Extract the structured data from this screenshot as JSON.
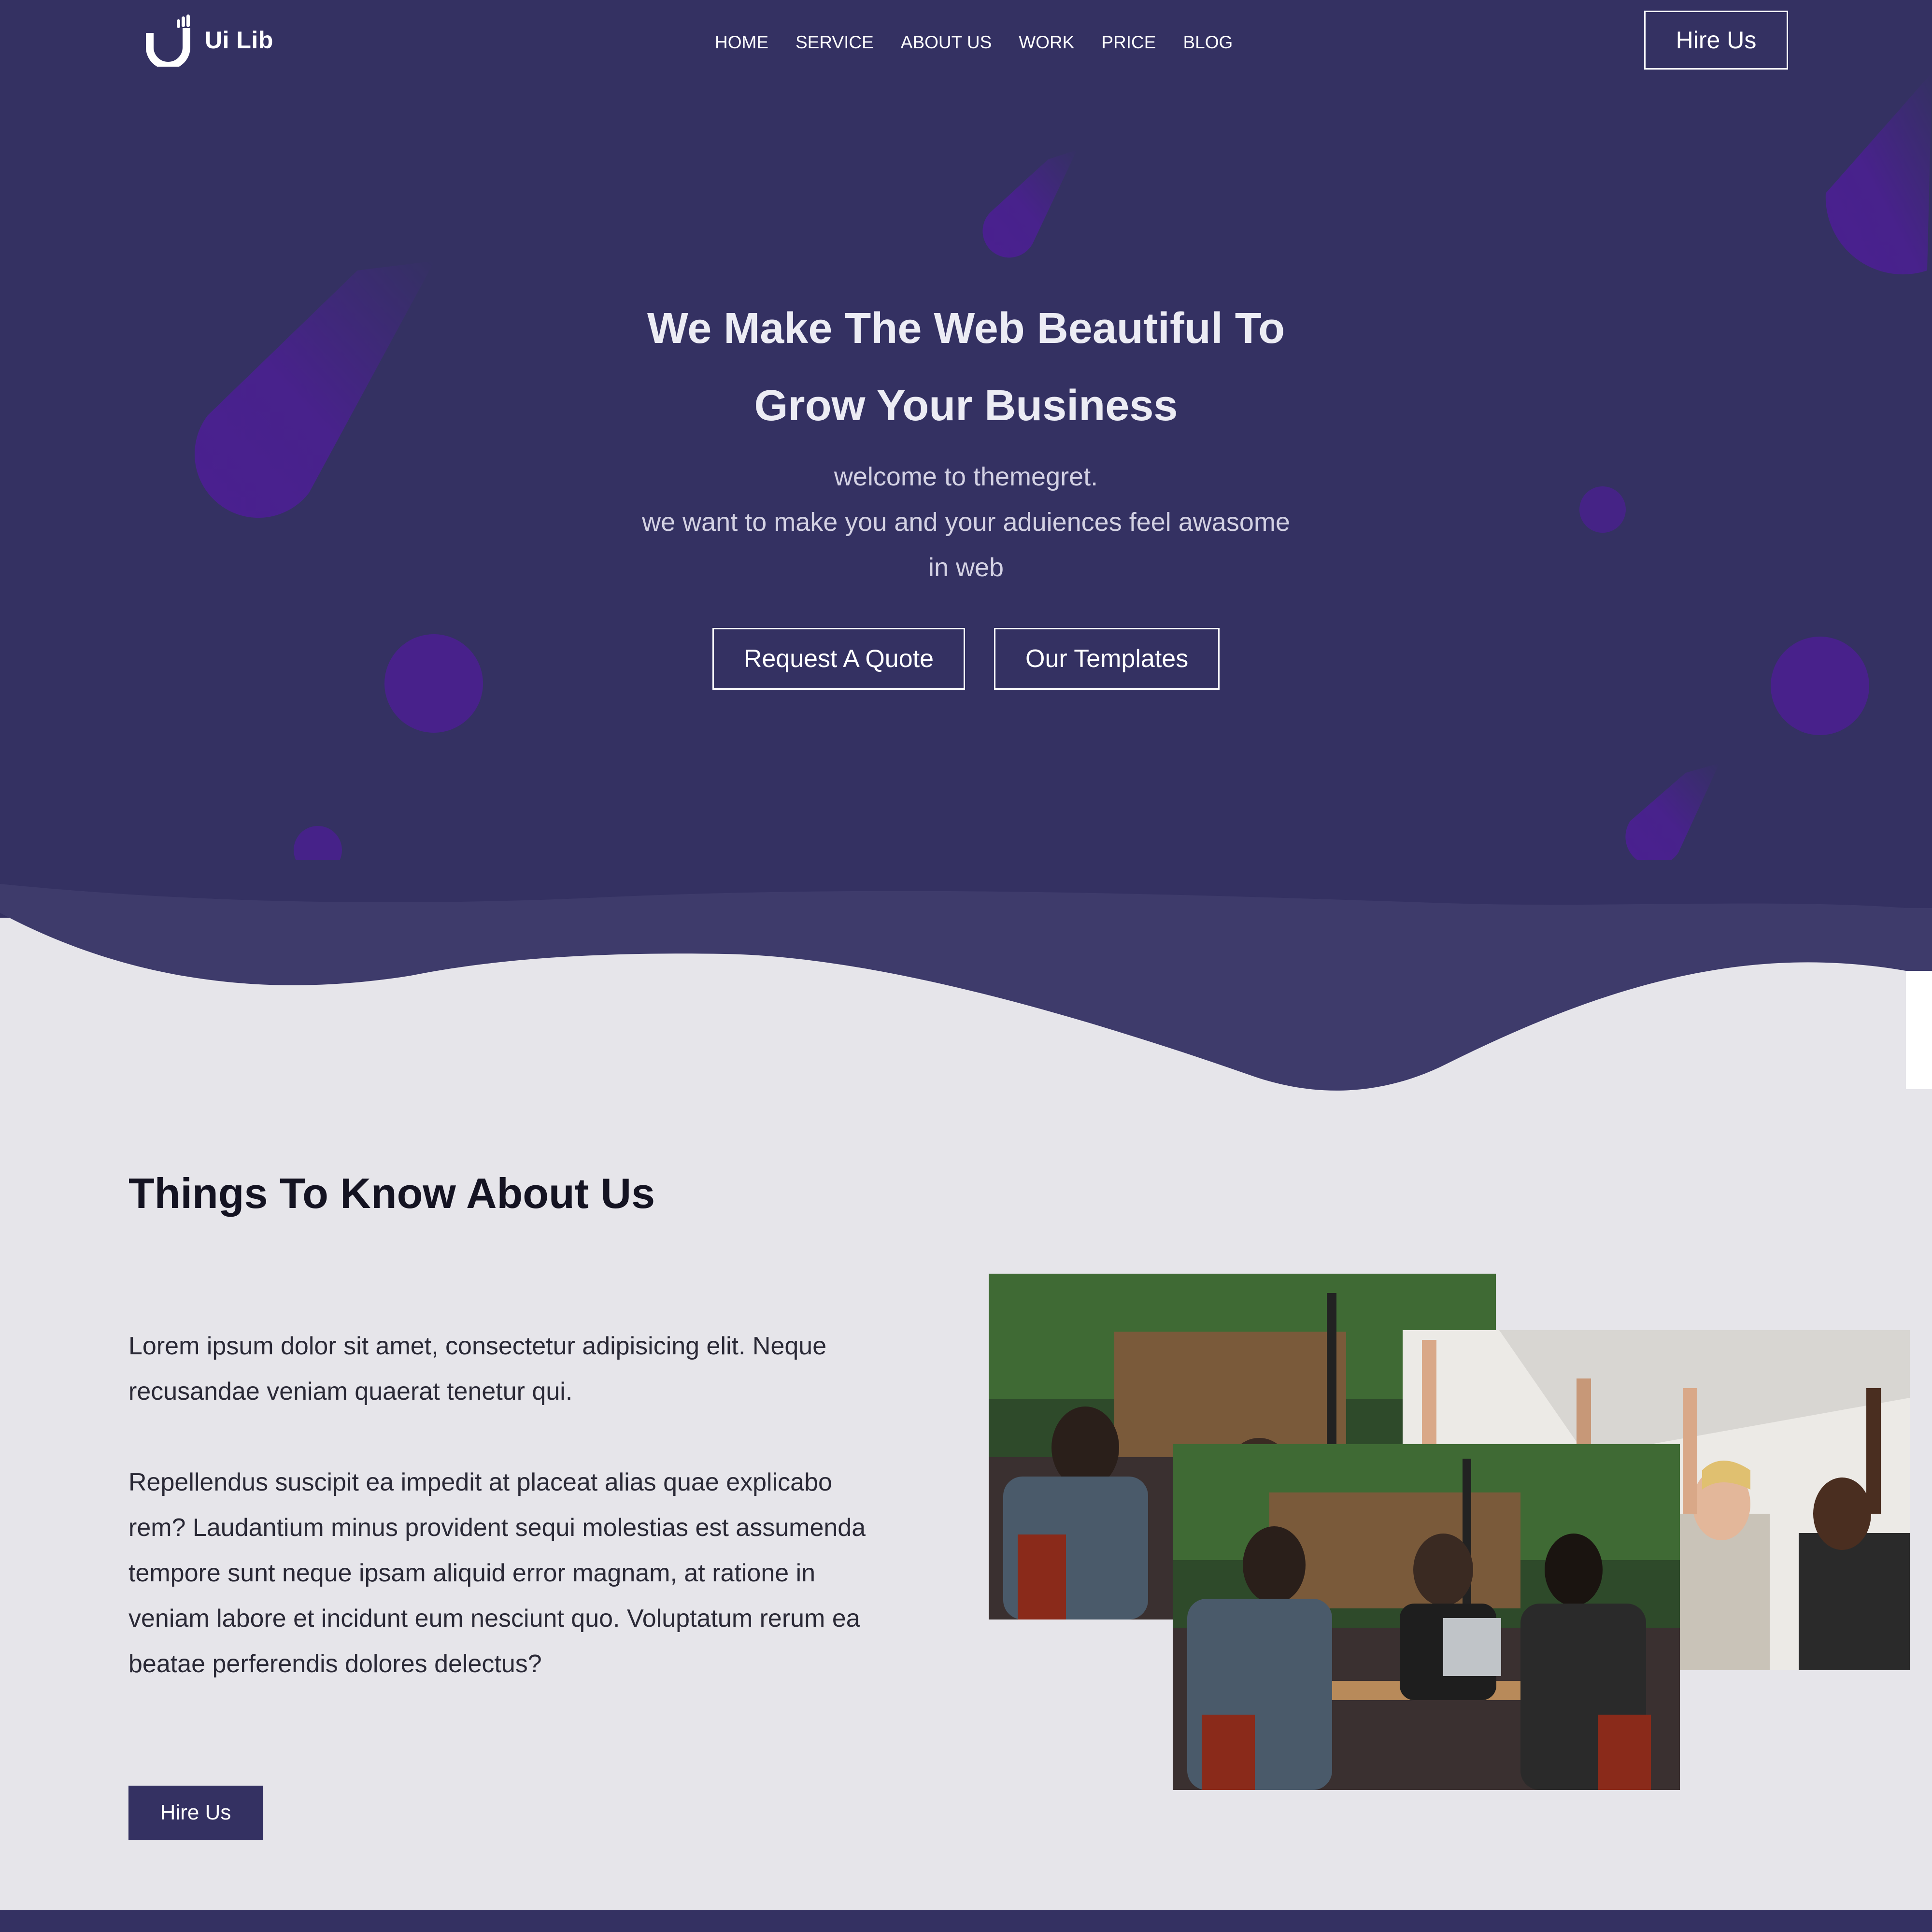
{
  "brand": {
    "name": "Ui Lib",
    "logo_icon": "hand-u-logo"
  },
  "nav": {
    "items": [
      {
        "label": "HOME"
      },
      {
        "label": "SERVICE"
      },
      {
        "label": "ABOUT US"
      },
      {
        "label": "WORK"
      },
      {
        "label": "PRICE"
      },
      {
        "label": "BLOG"
      }
    ],
    "hire_label": "Hire Us"
  },
  "hero": {
    "title_line1": "We Make The Web Beautiful To",
    "title_line2": "Grow Your Business",
    "sub_line1": "welcome to themegret.",
    "sub_line2": "we want to make you and your aduiences feel awasome",
    "sub_line3": "in web",
    "primary_button": "Request A Quote",
    "secondary_button": "Our Templates"
  },
  "about": {
    "title": "Things To Know About Us",
    "paragraph1": "Lorem ipsum dolor sit amet, consectetur adipisicing elit. Neque recusandae veniam quaerat tenetur qui.",
    "paragraph2": "Repellendus suscipit ea impedit at placeat alias quae explicabo rem? Laudantium minus provident sequi molestias est assumenda tempore sunt neque ipsam aliquid error magnam, at ratione in veniam labore et incidunt eum nesciunt quo. Voluptatum rerum ea beatae perferendis dolores delectus?",
    "button": "Hire Us"
  },
  "colors": {
    "hero_bg": "#343162",
    "wave_bg": "#3e3b6b",
    "accent_purple": "#4a2090",
    "page_bg": "#e6e5ea"
  }
}
